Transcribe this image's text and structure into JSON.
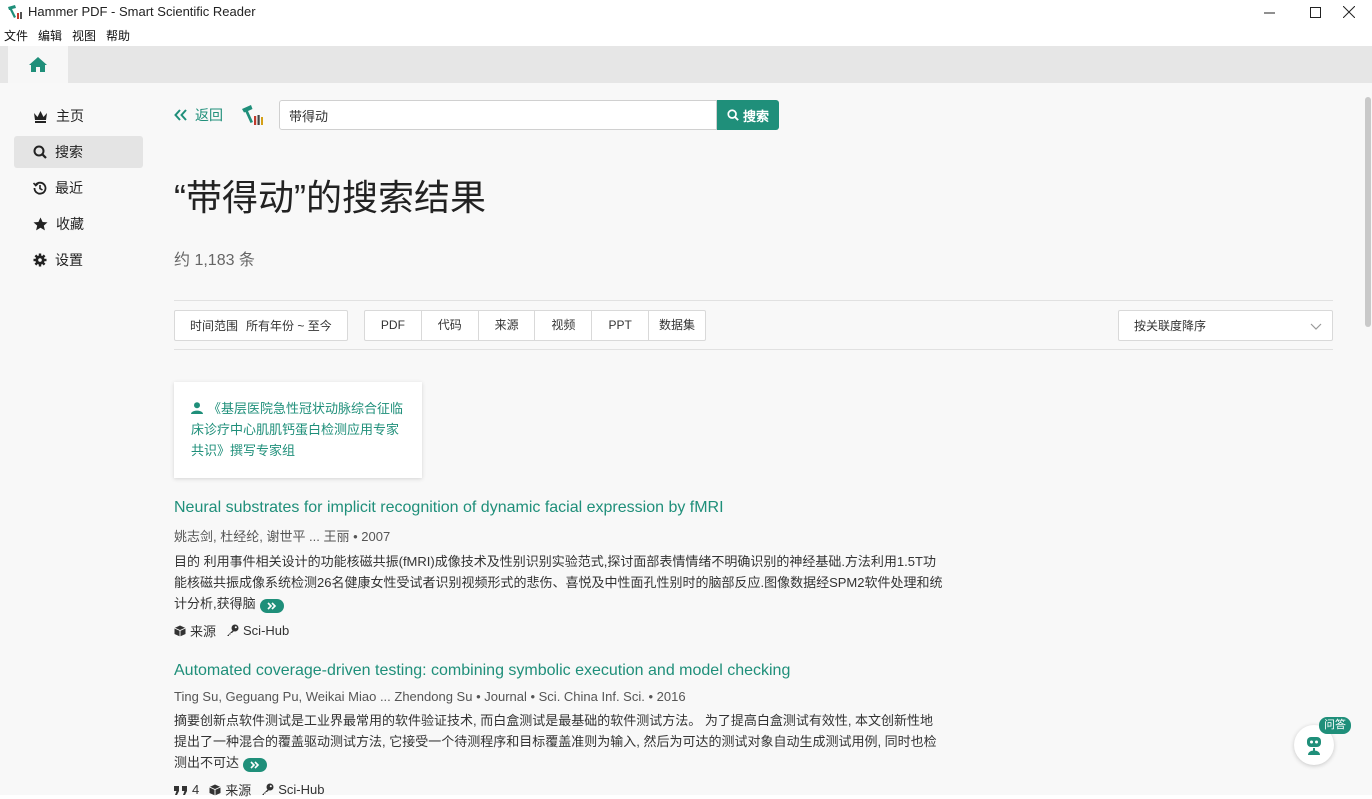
{
  "window": {
    "title": "Hammer PDF - Smart Scientific Reader"
  },
  "menu": [
    "文件",
    "编辑",
    "视图",
    "帮助"
  ],
  "sidebar": {
    "items": [
      {
        "label": "主页",
        "icon": "crown-icon"
      },
      {
        "label": "搜索",
        "icon": "search-icon",
        "active": true
      },
      {
        "label": "最近",
        "icon": "history-icon"
      },
      {
        "label": "收藏",
        "icon": "star-icon"
      },
      {
        "label": "设置",
        "icon": "gear-icon"
      }
    ]
  },
  "search": {
    "back_label": "返回",
    "query": "带得动",
    "button_label": "搜索"
  },
  "results": {
    "heading": "“带得动”的搜索结果",
    "count": "约 1,183 条"
  },
  "filters": {
    "time_label": "时间范围",
    "time_value": "所有年份 ~ 至今",
    "types": [
      "PDF",
      "代码",
      "来源",
      "视频",
      "PPT",
      "数据集"
    ],
    "sort": "按关联度降序"
  },
  "author_card": {
    "text": "《基层医院急性冠状动脉综合征临床诊疗中心肌肌钙蛋白检测应用专家共识》撰写专家组"
  },
  "items": [
    {
      "title": "Neural substrates for implicit recognition of dynamic facial expression by fMRI",
      "meta": "姚志剑, 杜经纶, 谢世平 ... 王丽  •  2007",
      "abstract": "目的 利用事件相关设计的功能核磁共振(fMRI)成像技术及性别识别实验范式,探讨面部表情情绪不明确识别的神经基础.方法利用1.5T功能核磁共振成像系统检测26名健康女性受试者识别视频形式的悲伤、喜悦及中性面孔性别时的脑部反应.图像数据经SPM2软件处理和统计分析,获得脑",
      "links": [
        "来源",
        "Sci-Hub"
      ]
    },
    {
      "title": "Automated coverage-driven testing: combining symbolic execution and model checking",
      "meta": "Ting Su, Geguang Pu, Weikai Miao ... Zhendong Su  •  Journal  •  Sci. China Inf. Sci.  •  2016",
      "abstract": "摘要创新点软件测试是工业界最常用的软件验证技术, 而白盒测试是最基础的软件测试方法。 为了提高白盒测试有效性, 本文创新性地提出了一种混合的覆盖驱动测试方法, 它接受一个待测程序和目标覆盖准则为输入, 然后为可达的测试对象自动生成测试用例, 同时也检测出不可达",
      "citations": "4",
      "links": [
        "来源",
        "Sci-Hub"
      ]
    }
  ],
  "qa": {
    "badge": "问答"
  },
  "colors": {
    "accent": "#1f8f7a",
    "sidebar_bg": "#f8f8f8",
    "tab_strip": "#e6e6e6"
  }
}
